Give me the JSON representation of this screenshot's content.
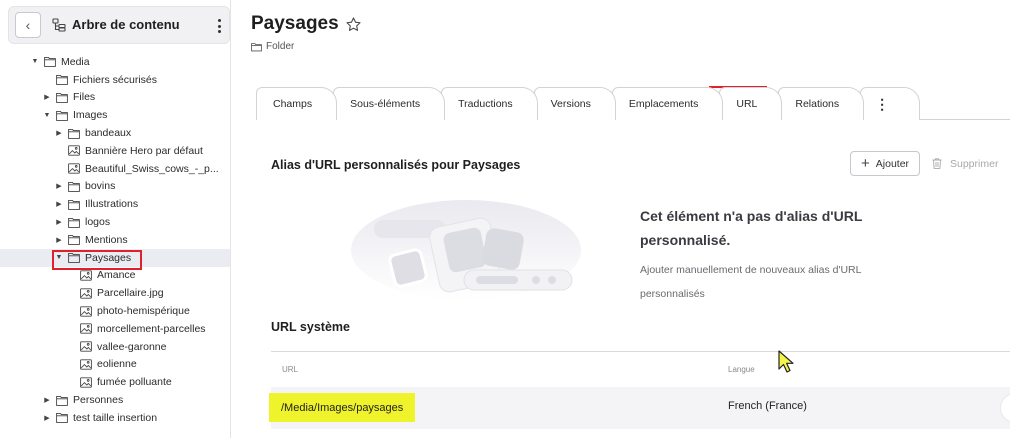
{
  "sidebar": {
    "back_icon": "chevron-left-icon",
    "title": "Arbre de contenu",
    "tree": [
      {
        "label": "Media",
        "indent": 0,
        "caret": "down",
        "icon": "folder"
      },
      {
        "label": "Fichiers sécurisés",
        "indent": 1,
        "caret": "none",
        "icon": "folder"
      },
      {
        "label": "Files",
        "indent": 1,
        "caret": "right",
        "icon": "folder"
      },
      {
        "label": "Images",
        "indent": 1,
        "caret": "down",
        "icon": "folder"
      },
      {
        "label": "bandeaux",
        "indent": 2,
        "caret": "right",
        "icon": "folder"
      },
      {
        "label": "Bannière Hero par défaut",
        "indent": 2,
        "caret": "none",
        "icon": "image"
      },
      {
        "label": "Beautiful_Swiss_cows_-_p...",
        "indent": 2,
        "caret": "none",
        "icon": "image"
      },
      {
        "label": "bovins",
        "indent": 2,
        "caret": "right",
        "icon": "folder"
      },
      {
        "label": "Illustrations",
        "indent": 2,
        "caret": "right",
        "icon": "folder"
      },
      {
        "label": "logos",
        "indent": 2,
        "caret": "right",
        "icon": "folder"
      },
      {
        "label": "Mentions",
        "indent": 2,
        "caret": "right",
        "icon": "folder"
      },
      {
        "label": "Paysages",
        "indent": 2,
        "caret": "down",
        "icon": "folder",
        "selected": true
      },
      {
        "label": "Amance",
        "indent": 3,
        "caret": "none",
        "icon": "image"
      },
      {
        "label": "Parcellaire.jpg",
        "indent": 3,
        "caret": "none",
        "icon": "image"
      },
      {
        "label": "photo-hemispérique",
        "indent": 3,
        "caret": "none",
        "icon": "image"
      },
      {
        "label": "morcellement-parcelles",
        "indent": 3,
        "caret": "none",
        "icon": "image"
      },
      {
        "label": "vallee-garonne",
        "indent": 3,
        "caret": "none",
        "icon": "image"
      },
      {
        "label": "eolienne",
        "indent": 3,
        "caret": "none",
        "icon": "image"
      },
      {
        "label": "fumée polluante",
        "indent": 3,
        "caret": "none",
        "icon": "image"
      },
      {
        "label": "Personnes",
        "indent": 1,
        "caret": "right",
        "icon": "folder"
      },
      {
        "label": "test taille insertion",
        "indent": 1,
        "caret": "right",
        "icon": "folder"
      }
    ]
  },
  "header": {
    "title": "Paysages",
    "type_label": "Folder"
  },
  "tabs": [
    {
      "label": "Champs"
    },
    {
      "label": "Sous-éléments"
    },
    {
      "label": "Traductions"
    },
    {
      "label": "Versions"
    },
    {
      "label": "Emplacements"
    },
    {
      "label": "URL",
      "active": true
    },
    {
      "label": "Relations"
    },
    {
      "label": "⋮"
    }
  ],
  "alias": {
    "heading": "Alias d'URL personnalisés pour Paysages",
    "add_label": "Ajouter",
    "delete_label": "Supprimer",
    "empty_title": "Cet élément n'a pas d'alias d'URL personnalisé.",
    "empty_desc": "Ajouter manuellement de nouveaux alias d'URL personnalisés"
  },
  "system_url": {
    "heading": "URL système",
    "col_url": "URL",
    "col_lang": "Langue",
    "rows": [
      {
        "url": "/Media/Images/paysages",
        "lang": "French (France)"
      }
    ]
  },
  "colors": {
    "highlight_red": "#e0202a",
    "highlight_yellow": "#eef32b"
  }
}
